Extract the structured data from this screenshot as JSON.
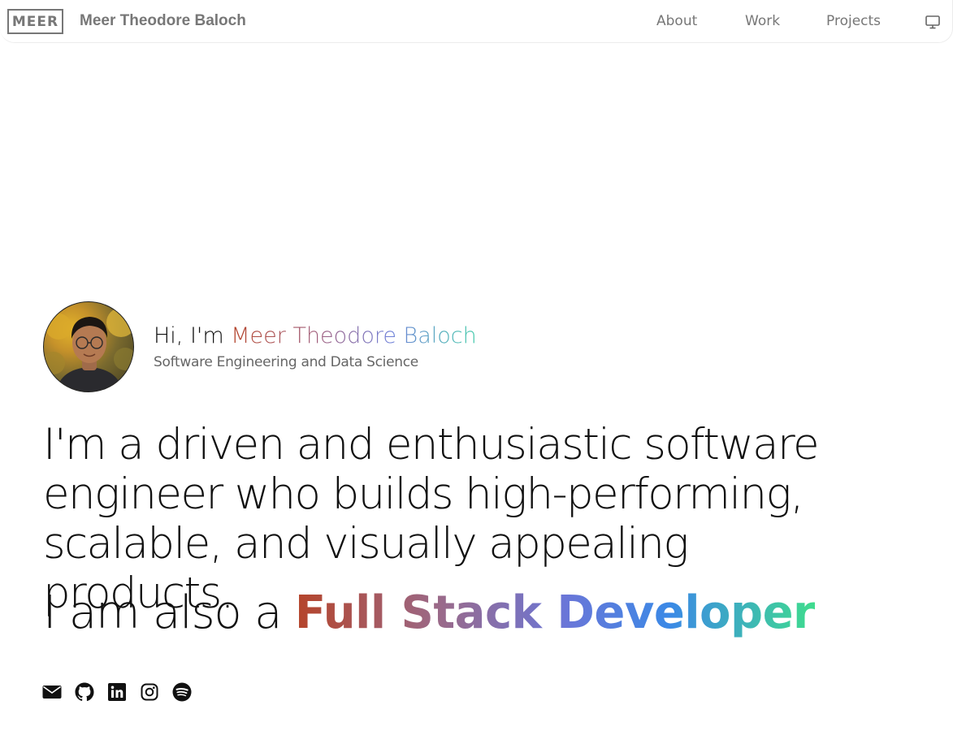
{
  "header": {
    "logo_text": "MEER",
    "brand_name": "Meer Theodore Baloch",
    "nav": {
      "about": "About",
      "work": "Work",
      "projects": "Projects"
    },
    "theme_toggle_icon": "monitor-icon"
  },
  "intro": {
    "greeting_prefix": "Hi, I'm ",
    "name": "Meer Theodore Baloch",
    "subtitle": "Software Engineering and Data Science",
    "avatar_icon": "profile-photo"
  },
  "statement": {
    "text": "I'm a driven and enthusiastic software engineer who builds high-performing, scalable, and visually appealing products.",
    "role_prefix": "I am also a ",
    "role": "Full Stack Developer"
  },
  "socials": [
    {
      "icon": "email-icon"
    },
    {
      "icon": "github-icon"
    },
    {
      "icon": "linkedin-icon"
    },
    {
      "icon": "instagram-icon"
    },
    {
      "icon": "spotify-icon"
    }
  ],
  "colors": {
    "gradient_start": "#b5442a",
    "gradient_mid": "#6a76d8",
    "gradient_end": "#3fdc8e",
    "nav_text": "#777777"
  }
}
